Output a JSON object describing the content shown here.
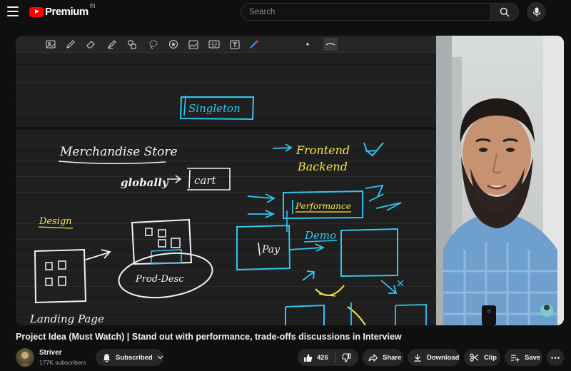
{
  "header": {
    "logo_text": "Premium",
    "logo_region": "IN",
    "search": {
      "placeholder": "Search",
      "value": ""
    }
  },
  "whiteboard": {
    "tools": [
      "photo-icon",
      "pen-icon",
      "eraser-icon",
      "highlighter-icon",
      "shapes-icon",
      "lasso-icon",
      "sticker-icon",
      "image-icon",
      "keyboard-icon",
      "text-icon",
      "laser-pointer-icon",
      "dot-size-icon",
      "stroke-style-icon"
    ],
    "notes": {
      "singleton": "Singleton",
      "merchandise": "Merchandise Store",
      "globally": "globally",
      "cart": "cart",
      "frontend": "Frontend",
      "backend": "Backend",
      "performance": "Performance",
      "design": "Design",
      "demo": "Demo",
      "product_desc": "Prod-Desc",
      "landing_page": "Landing Page",
      "pay": "Pay"
    },
    "colors": {
      "ink_white": "#f2f2f2",
      "ink_cyan": "#2fc7f0",
      "ink_yellow": "#f5e642"
    }
  },
  "video": {
    "title": "Project Idea (Must Watch) | Stand out with performance, trade-offs discussions in Interview"
  },
  "channel": {
    "name": "Striver",
    "subscribers": "177K subscribers",
    "subscribe_label": "Subscribed"
  },
  "actions": {
    "like_count": "426",
    "share_label": "Share",
    "download_label": "Download",
    "clip_label": "Clip",
    "save_label": "Save"
  }
}
